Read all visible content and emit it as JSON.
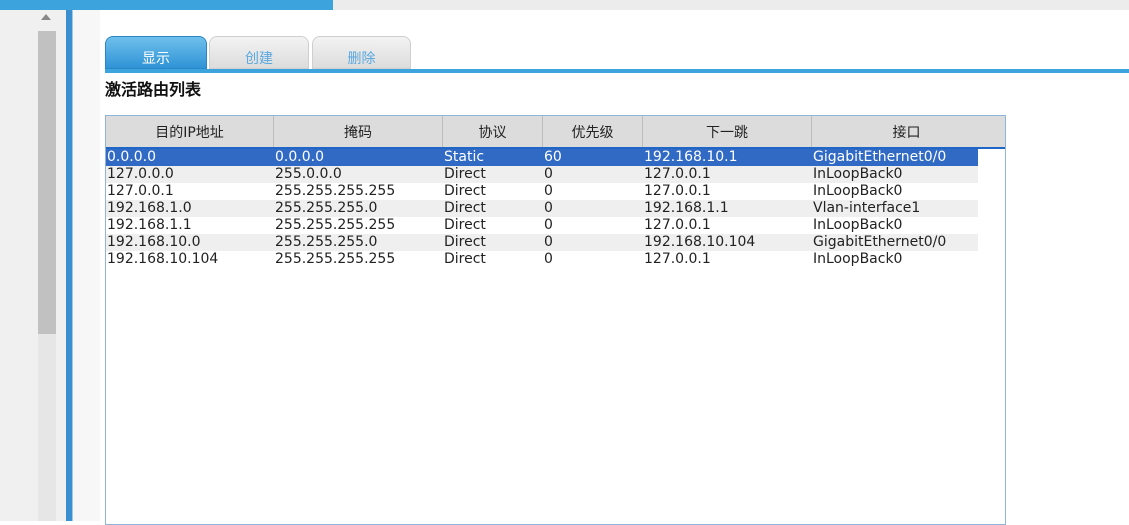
{
  "tabs": [
    {
      "label": "显示"
    },
    {
      "label": "创建"
    },
    {
      "label": "删除"
    }
  ],
  "section_title": "激活路由列表",
  "table": {
    "headers": [
      "目的IP地址",
      "掩码",
      "协议",
      "优先级",
      "下一跳",
      "接口"
    ],
    "rows": [
      [
        "0.0.0.0",
        "0.0.0.0",
        "Static",
        "60",
        "192.168.10.1",
        "GigabitEthernet0/0"
      ],
      [
        "127.0.0.0",
        "255.0.0.0",
        "Direct",
        "0",
        "127.0.0.1",
        "InLoopBack0"
      ],
      [
        "127.0.0.1",
        "255.255.255.255",
        "Direct",
        "0",
        "127.0.0.1",
        "InLoopBack0"
      ],
      [
        "192.168.1.0",
        "255.255.255.0",
        "Direct",
        "0",
        "192.168.1.1",
        "Vlan-interface1"
      ],
      [
        "192.168.1.1",
        "255.255.255.255",
        "Direct",
        "0",
        "127.0.0.1",
        "InLoopBack0"
      ],
      [
        "192.168.10.0",
        "255.255.255.0",
        "Direct",
        "0",
        "192.168.10.104",
        "GigabitEthernet0/0"
      ],
      [
        "192.168.10.104",
        "255.255.255.255",
        "Direct",
        "0",
        "127.0.0.1",
        "InLoopBack0"
      ]
    ],
    "selected_row": 0
  },
  "colors": {
    "accent": "#3da3dd",
    "selection": "#316ac5",
    "header_bg": "#dcdcdc"
  }
}
